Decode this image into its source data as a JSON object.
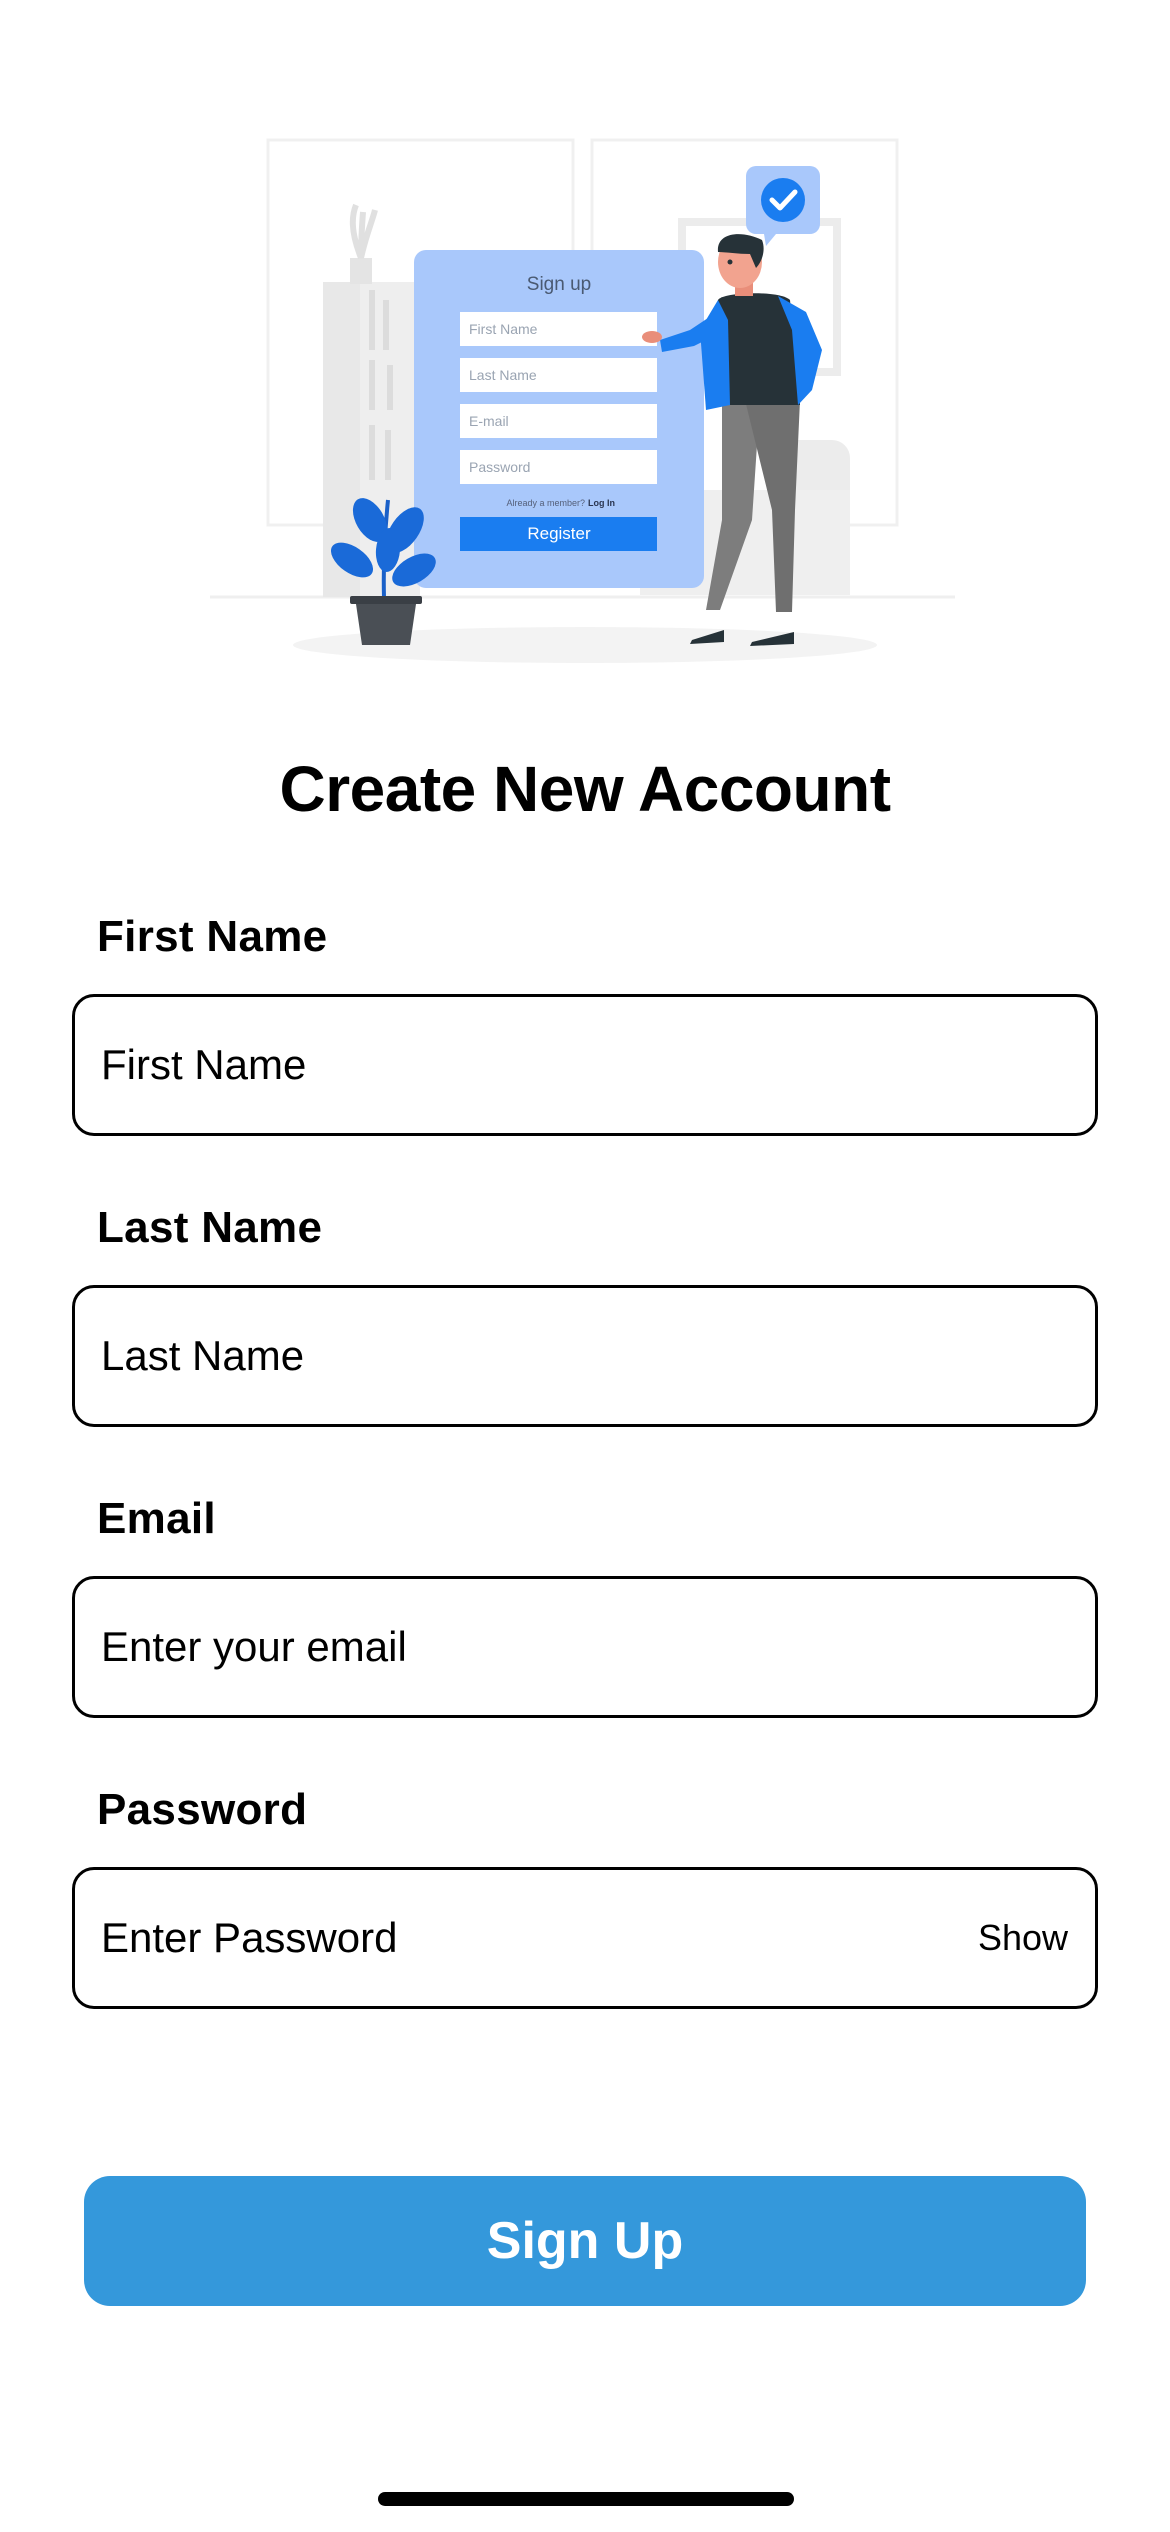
{
  "illustration": {
    "card_title": "Sign up",
    "fields": [
      "First Name",
      "Last Name",
      "E-mail",
      "Password"
    ],
    "member_text": "Already a member?",
    "login_link": "Log In",
    "register_label": "Register",
    "colors": {
      "card": "#a9c8fb",
      "button": "#1a7df0",
      "jacket": "#1a7df0"
    }
  },
  "title": "Create New Account",
  "form": {
    "first_name": {
      "label": "First Name",
      "placeholder": "First Name"
    },
    "last_name": {
      "label": "Last Name",
      "placeholder": "Last Name"
    },
    "email": {
      "label": "Email",
      "placeholder": "Enter your email"
    },
    "password": {
      "label": "Password",
      "placeholder": "Enter Password",
      "toggle": "Show"
    }
  },
  "submit_label": "Sign Up",
  "colors": {
    "primary": "#3498db"
  }
}
